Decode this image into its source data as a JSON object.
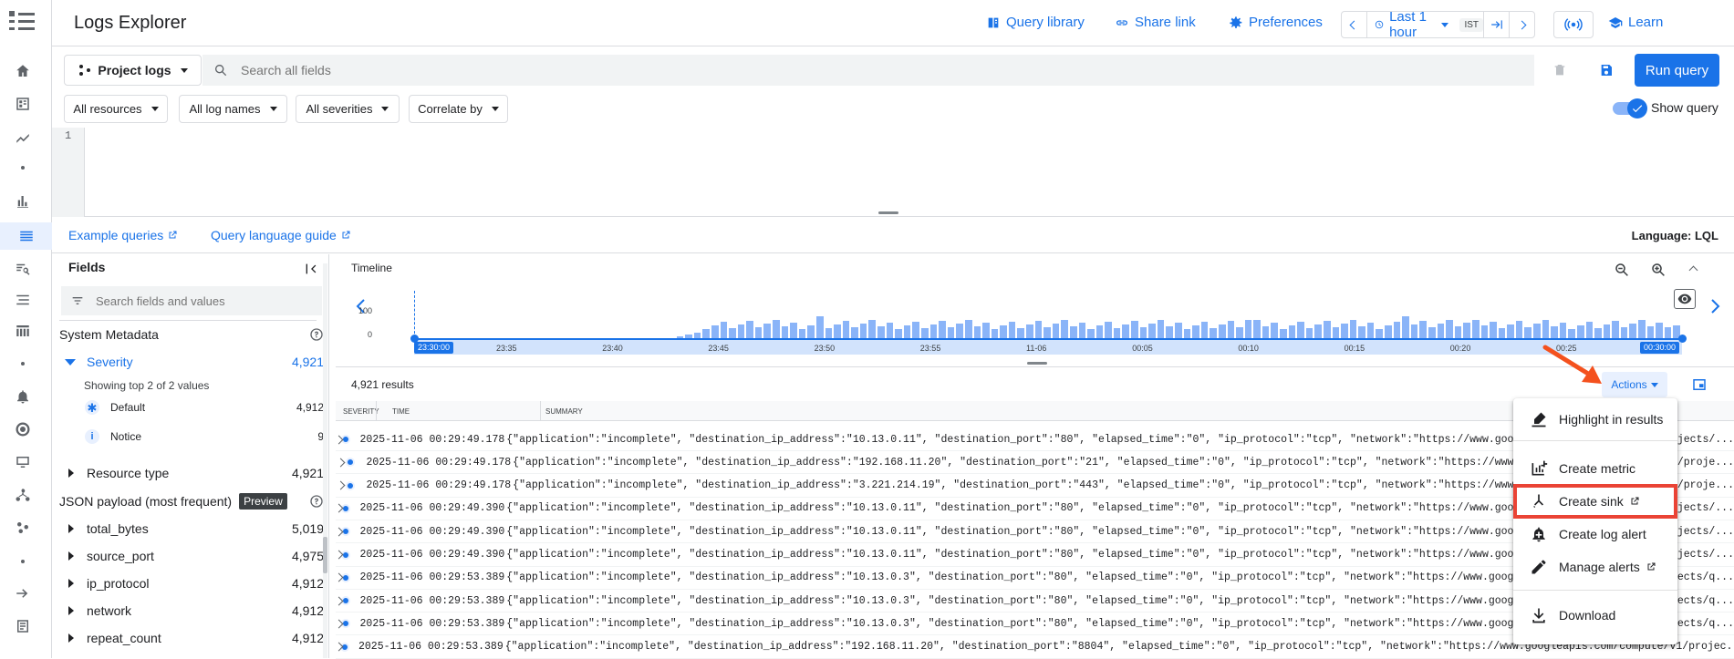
{
  "header": {
    "title": "Logs Explorer",
    "query_library": "Query library",
    "share_link": "Share link",
    "preferences": "Preferences",
    "time_range": "Last 1 hour",
    "timezone": "IST",
    "learn": "Learn"
  },
  "query_bar": {
    "project_logs": "Project logs",
    "search_placeholder": "Search all fields",
    "run_query": "Run query"
  },
  "filters": {
    "resources": "All resources",
    "log_names": "All log names",
    "severities": "All severities",
    "correlate": "Correlate by",
    "show_query": "Show query"
  },
  "editor": {
    "line_number": "1"
  },
  "links": {
    "example_queries": "Example queries",
    "query_language_guide": "Query language guide",
    "language": "Language: LQL"
  },
  "fields_panel": {
    "title": "Fields",
    "search_placeholder": "Search fields and values",
    "system_metadata": "System Metadata",
    "severity_label": "Severity",
    "severity_count": "4,921",
    "showing_top": "Showing top 2 of 2 values",
    "default_label": "Default",
    "default_count": "4,912",
    "notice_label": "Notice",
    "notice_count": "9",
    "resource_type_label": "Resource type",
    "resource_type_count": "4,921",
    "json_payload": "JSON payload (most frequent)",
    "preview_badge": "Preview",
    "payload_fields": [
      {
        "name": "total_bytes",
        "count": "5,019"
      },
      {
        "name": "source_port",
        "count": "4,975"
      },
      {
        "name": "ip_protocol",
        "count": "4,912"
      },
      {
        "name": "network",
        "count": "4,912"
      },
      {
        "name": "repeat_count",
        "count": "4,912"
      }
    ]
  },
  "timeline": {
    "title": "Timeline",
    "y_labels": [
      "100",
      "0"
    ],
    "start_label": "23:30:00",
    "end_label": "00:30:00",
    "x_labels": [
      "23:35",
      "23:40",
      "23:45",
      "23:50",
      "23:55",
      "11-06",
      "00:05",
      "00:10",
      "00:15",
      "00:20",
      "00:25"
    ]
  },
  "results": {
    "count": "4,921 results",
    "actions": "Actions",
    "col_severity": "SEVERITY",
    "col_time": "TIME",
    "col_summary": "SUMMARY",
    "rows": [
      {
        "time": "2025-11-06 00:29:49.178",
        "summary": "{\"application\":\"incomplete\", \"destination_ip_address\":\"10.13.0.11\", \"destination_port\":\"80\", \"elapsed_time\":\"0\", \"ip_protocol\":\"tcp\", \"network\":\"https://www.googleapis.com/compute/v1/projects/..."
      },
      {
        "time": "2025-11-06 00:29:49.178",
        "summary": "{\"application\":\"incomplete\", \"destination_ip_address\":\"192.168.11.20\", \"destination_port\":\"21\", \"elapsed_time\":\"0\", \"ip_protocol\":\"tcp\", \"network\":\"https://www.googleapis.com/compute/v1/proje..."
      },
      {
        "time": "2025-11-06 00:29:49.178",
        "summary": "{\"application\":\"incomplete\", \"destination_ip_address\":\"3.221.214.19\", \"destination_port\":\"443\", \"elapsed_time\":\"0\", \"ip_protocol\":\"tcp\", \"network\":\"https://www.googleapis.com/compute/v1/proje..."
      },
      {
        "time": "2025-11-06 00:29:49.390",
        "summary": "{\"application\":\"incomplete\", \"destination_ip_address\":\"10.13.0.11\", \"destination_port\":\"80\", \"elapsed_time\":\"0\", \"ip_protocol\":\"tcp\", \"network\":\"https://www.googleapis.com/compute/v1/projects/..."
      },
      {
        "time": "2025-11-06 00:29:49.390",
        "summary": "{\"application\":\"incomplete\", \"destination_ip_address\":\"10.13.0.11\", \"destination_port\":\"80\", \"elapsed_time\":\"0\", \"ip_protocol\":\"tcp\", \"network\":\"https://www.googleapis.com/compute/v1/projects/..."
      },
      {
        "time": "2025-11-06 00:29:49.390",
        "summary": "{\"application\":\"incomplete\", \"destination_ip_address\":\"10.13.0.11\", \"destination_port\":\"80\", \"elapsed_time\":\"0\", \"ip_protocol\":\"tcp\", \"network\":\"https://www.googleapis.com/compute/v1/projects/..."
      },
      {
        "time": "2025-11-06 00:29:53.389",
        "summary": "{\"application\":\"incomplete\", \"destination_ip_address\":\"10.13.0.3\", \"destination_port\":\"80\", \"elapsed_time\":\"0\", \"ip_protocol\":\"tcp\", \"network\":\"https://www.googleapis.com/compute/v1/projects/q..."
      },
      {
        "time": "2025-11-06 00:29:53.389",
        "summary": "{\"application\":\"incomplete\", \"destination_ip_address\":\"10.13.0.3\", \"destination_port\":\"80\", \"elapsed_time\":\"0\", \"ip_protocol\":\"tcp\", \"network\":\"https://www.googleapis.com/compute/v1/projects/q..."
      },
      {
        "time": "2025-11-06 00:29:53.389",
        "summary": "{\"application\":\"incomplete\", \"destination_ip_address\":\"10.13.0.3\", \"destination_port\":\"80\", \"elapsed_time\":\"0\", \"ip_protocol\":\"tcp\", \"network\":\"https://www.googleapis.com/compute/v1/projects/q..."
      },
      {
        "time": "2025-11-06 00:29:53.389",
        "summary": "{\"application\":\"incomplete\", \"destination_ip_address\":\"192.168.11.20\", \"destination_port\":\"8804\", \"elapsed_time\":\"0\", \"ip_protocol\":\"tcp\", \"network\":\"https://www.googleapis.com/compute/v1/projec..."
      }
    ]
  },
  "actions_menu": {
    "highlight": "Highlight in results",
    "create_metric": "Create metric",
    "create_sink": "Create sink",
    "create_log_alert": "Create log alert",
    "manage_alerts": "Manage alerts",
    "download": "Download"
  },
  "colors": {
    "accent": "#1a73e8",
    "highlight_box": "#ea4335",
    "arrow": "#f4511e"
  }
}
